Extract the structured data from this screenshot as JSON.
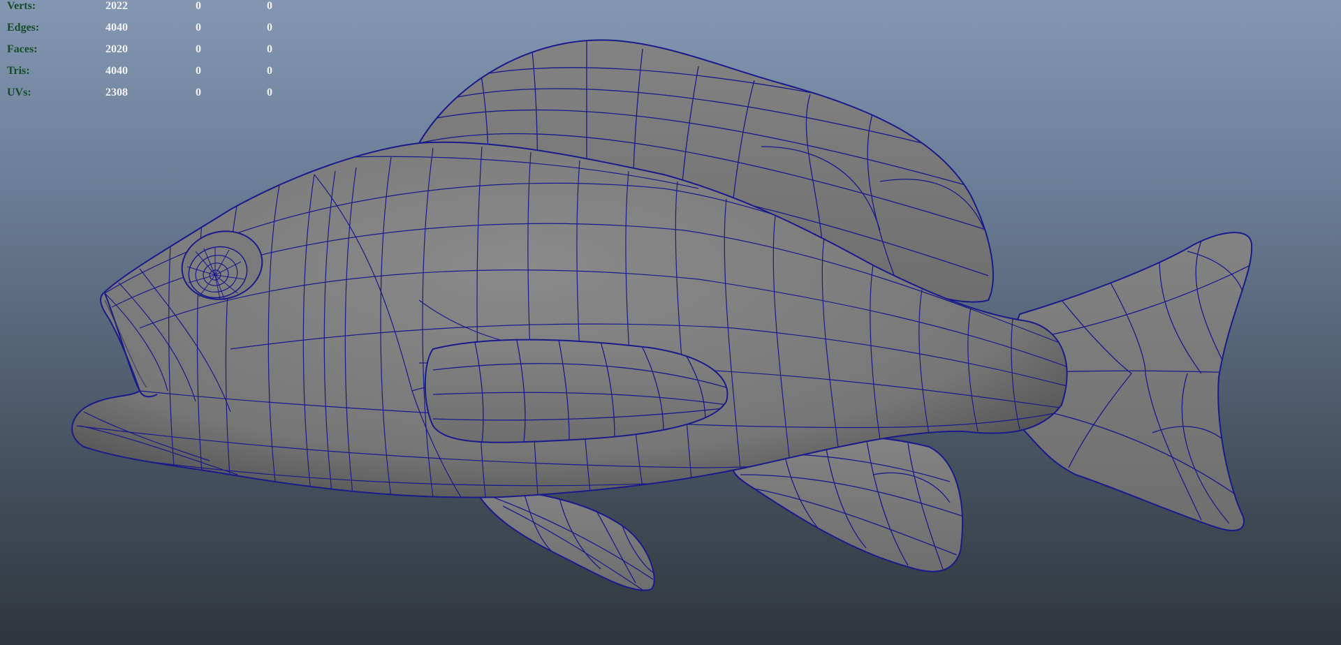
{
  "hud": {
    "rows": [
      {
        "label": "Verts:",
        "values": [
          "2022",
          "0",
          "0"
        ]
      },
      {
        "label": "Edges:",
        "values": [
          "4040",
          "0",
          "0"
        ]
      },
      {
        "label": "Faces:",
        "values": [
          "2020",
          "0",
          "0"
        ]
      },
      {
        "label": "Tris:",
        "values": [
          "4040",
          "0",
          "0"
        ]
      },
      {
        "label": "UVs:",
        "values": [
          "2308",
          "0",
          "0"
        ]
      }
    ]
  },
  "colors": {
    "hud_label": "#154d2a",
    "hud_value": "#f2f2f2",
    "wireframe": "#1a1a8a",
    "mesh_fill": "#7d7d7d",
    "background_top": "#8497b2",
    "background_bottom": "#2f353d"
  },
  "viewport": {
    "object": "fish-mesh",
    "display_mode": "smooth shaded with wireframe"
  }
}
